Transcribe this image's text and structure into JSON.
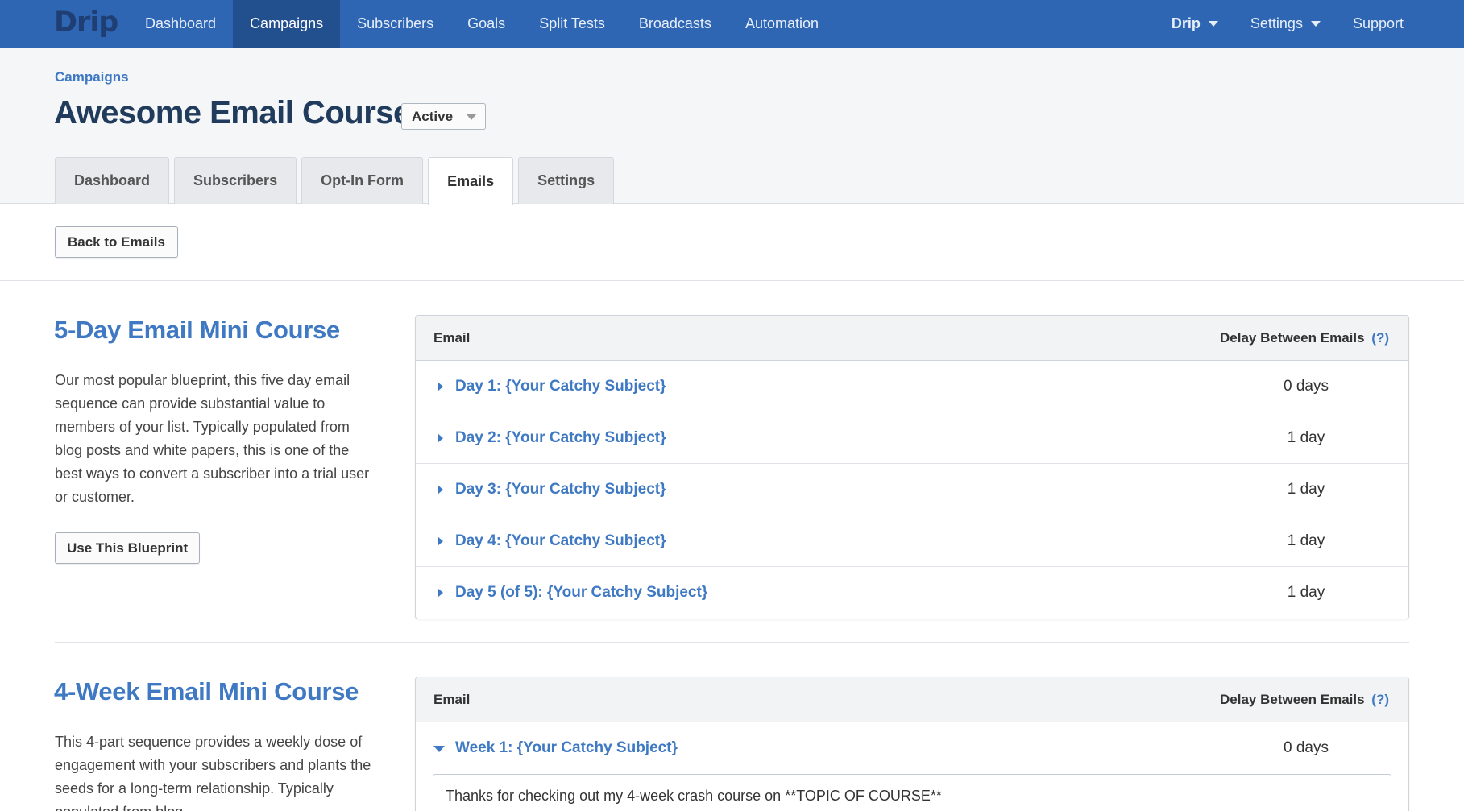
{
  "nav": {
    "logo": "Drip",
    "items": [
      "Dashboard",
      "Campaigns",
      "Subscribers",
      "Goals",
      "Split Tests",
      "Broadcasts",
      "Automation"
    ],
    "active": "Campaigns",
    "right": {
      "account": "Drip",
      "settings": "Settings",
      "support": "Support"
    }
  },
  "header": {
    "breadcrumb": "Campaigns",
    "title": "Awesome Email Course",
    "status": "Active",
    "tabs": [
      "Dashboard",
      "Subscribers",
      "Opt-In Form",
      "Emails",
      "Settings"
    ],
    "active_tab": "Emails"
  },
  "toolbar": {
    "back_label": "Back to Emails"
  },
  "blueprints": [
    {
      "title": "5-Day Email Mini Course",
      "description": "Our most popular blueprint, this five day email sequence can provide substantial value to members of your list. Typically populated from blog posts and white papers, this is one of the best ways to convert a subscriber into a trial user or customer.",
      "button_label": "Use This Blueprint",
      "table": {
        "col_email": "Email",
        "col_delay": "Delay Between Emails",
        "help": "(?)",
        "rows": [
          {
            "subject": "Day 1: {Your Catchy Subject}",
            "delay": "0 days"
          },
          {
            "subject": "Day 2: {Your Catchy Subject}",
            "delay": "1 day"
          },
          {
            "subject": "Day 3: {Your Catchy Subject}",
            "delay": "1 day"
          },
          {
            "subject": "Day 4: {Your Catchy Subject}",
            "delay": "1 day"
          },
          {
            "subject": "Day 5 (of 5): {Your Catchy Subject}",
            "delay": "1 day"
          }
        ]
      }
    },
    {
      "title": "4-Week Email Mini Course",
      "description": "This 4-part sequence provides a weekly dose of engagement with your subscribers and plants the seeds for a long-term relationship. Typically populated from blog",
      "table": {
        "col_email": "Email",
        "col_delay": "Delay Between Emails",
        "help": "(?)",
        "rows": [
          {
            "subject": "Week 1: {Your Catchy Subject}",
            "delay": "0 days",
            "body": "Thanks for checking out my 4-week crash course on **TOPIC OF COURSE**"
          }
        ]
      }
    }
  ]
}
